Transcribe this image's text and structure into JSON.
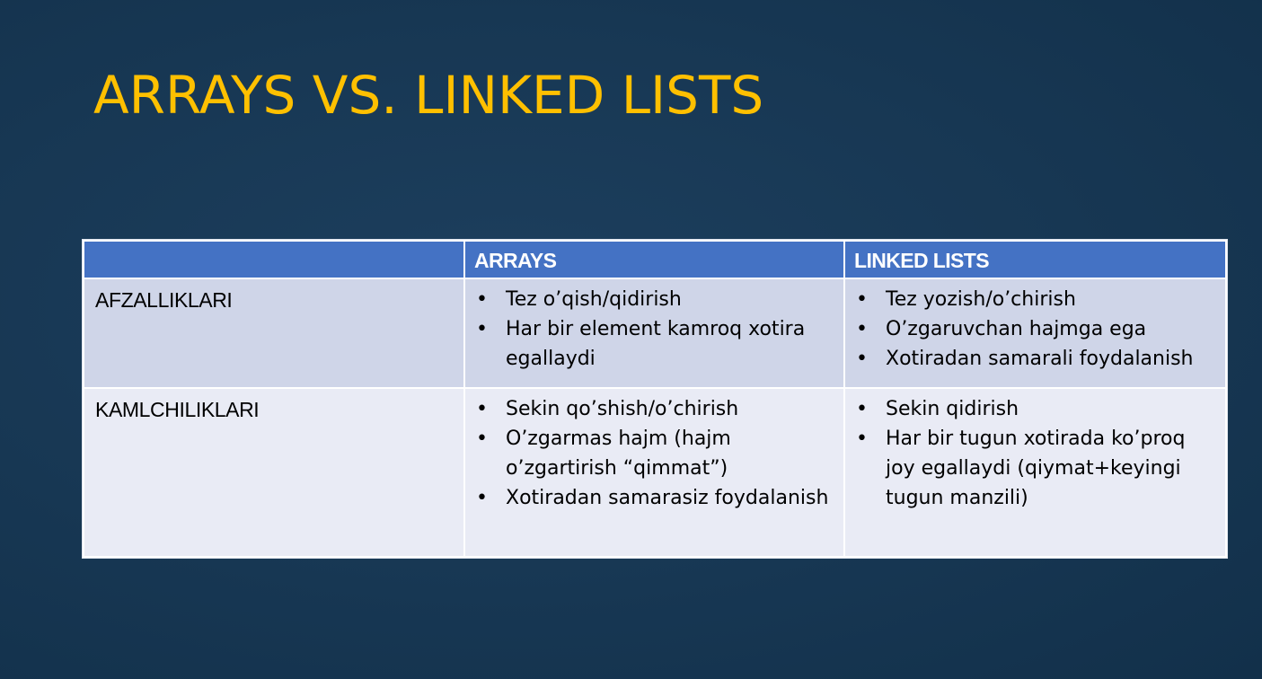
{
  "slide": {
    "title": "ARRAYS VS. LINKED LISTS"
  },
  "table": {
    "headers": [
      "",
      "ARRAYS",
      "LINKED LISTS"
    ],
    "rows": [
      {
        "label": "AFZALLIKLARI",
        "arrays": [
          "Tez o’qish/qidirish",
          "Har bir element kamroq xotira egallaydi"
        ],
        "linked_lists": [
          "Tez yozish/o’chirish",
          "O’zgaruvchan hajmga ega",
          "Xotiradan samarali foydalanish"
        ]
      },
      {
        "label": "KAMLCHILIKLARI",
        "arrays": [
          "Sekin qo’shish/o’chirish",
          "O’zgarmas hajm (hajm o’zgartirish “qimmat”)",
          "Xotiradan samarasiz foydalanish"
        ],
        "linked_lists": [
          "Sekin qidirish",
          "Har bir tugun xotirada ko’proq joy egallaydi (qiymat+keyingi tugun manzili)"
        ]
      }
    ]
  },
  "colors": {
    "background": "#173753",
    "title": "#ffc000",
    "header_fill": "#4472c4",
    "row_1_fill": "#cfd5e8",
    "row_2_fill": "#e9ebf5"
  },
  "icons": {
    "bullet": "bullet-dot-icon"
  }
}
